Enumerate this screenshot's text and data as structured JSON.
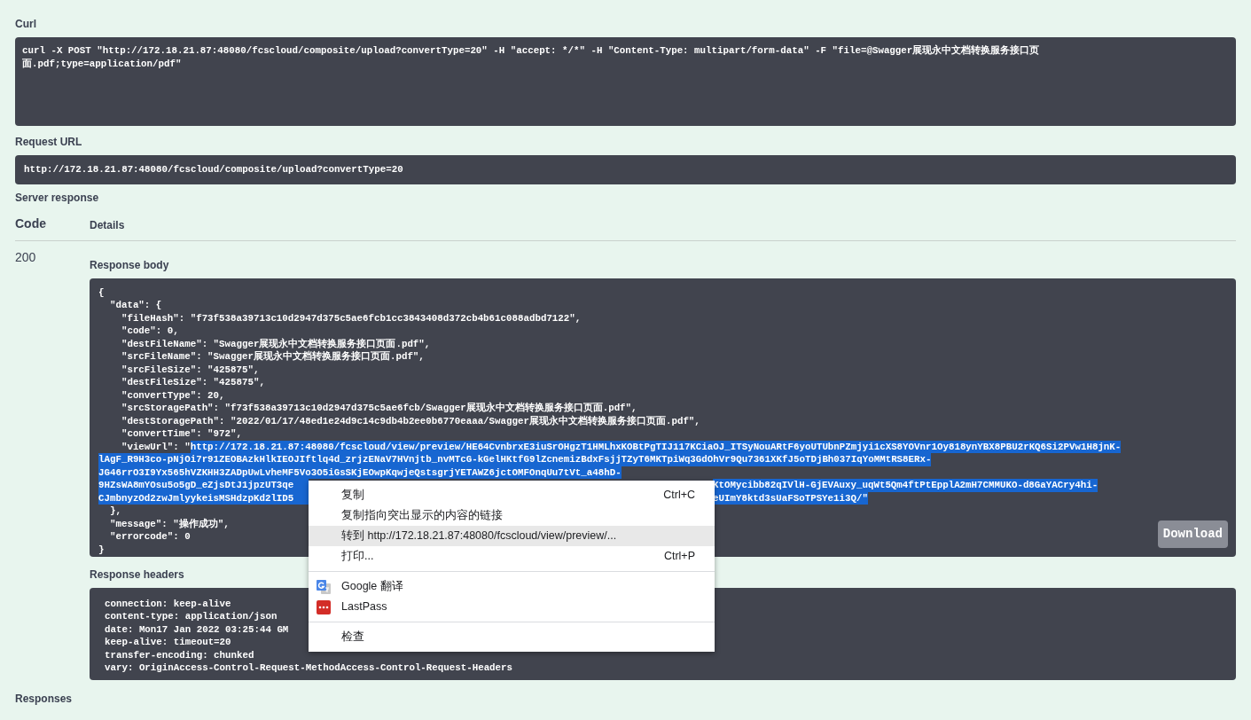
{
  "curl": {
    "label": "Curl",
    "lines": [
      "curl -X POST \"http://172.18.21.87:48080/fcscloud/composite/upload?convertType=20\" -H \"accept: */*\" -H \"Content-Type: multipart/form-data\" -F \"file=@Swagger展现永中文档转换服务接口页",
      "面.pdf;type=application/pdf\""
    ]
  },
  "request_url": {
    "label": "Request URL",
    "value": "http://172.18.21.87:48080/fcscloud/composite/upload?convertType=20"
  },
  "server_response": {
    "label": "Server response",
    "columns": [
      "Code",
      "Details"
    ],
    "code": "200",
    "response_body": {
      "label": "Response body",
      "lines": [
        "{",
        "  \"data\": {",
        "    \"fileHash\": \"f73f538a39713c10d2947d375c5ae6fcb1cc3843408d372cb4b61c088adbd7122\",",
        "    \"code\": 0,",
        "    \"destFileName\": \"Swagger展现永中文档转换服务接口页面.pdf\",",
        "    \"srcFileName\": \"Swagger展现永中文档转换服务接口页面.pdf\",",
        "    \"srcFileSize\": \"425875\",",
        "    \"destFileSize\": \"425875\",",
        "    \"convertType\": 20,",
        "    \"srcStoragePath\": \"f73f538a39713c10d2947d375c5ae6fcb/Swagger展现永中文档转换服务接口页面.pdf\",",
        "    \"destStoragePath\": \"2022/01/17/48ed1e24d9c14c9db4b2ee0b6770eaaa/Swagger展现永中文档转换服务接口页面.pdf\",",
        "    \"convertTime\": \"972\","
      ],
      "view_url": {
        "key": "    \"viewUrl\": \"",
        "highlighted": true,
        "lines": [
          {
            "left": "http://172.18.21.87:48080/fcscloud/view/preview/HE64CvnbrxE3iuSrOHgzT1HMLhxKOBtPgTIJ117KCiaOJ_ITSyNouARtF6yoUTUbnPZmjyi1cXS8YOVnr1Oy818ynYBX8PBU2rKQ6Si2PVw1H8jnK-"
          },
          {
            "left": "lAgF_R9H3co-pNjOi7r91ZEOBAzkHlkIEOJIftlq4d_zrjzENaV7HVnjtb_nvMTcG-kGelHKtfG9lZcnemizBdxFsjjTZyT6MKTpiWq3GdOhVr9Qu7361XKfJ5oTDjBh037IqYoMMtRS8ERx-"
          },
          {
            "left": "JG46rrO3I9Yx565hVZKHH3ZADpUwLvheMF5Vo3O5iGsSKjEOwpKqwjeQstsgrjYETAWZ6jctOMFOnqUu7tVt_a48hD-"
          },
          {
            "left": "9HZsWA8mYOsu5o5gD_eZjsDtJ1jpzUT3qe",
            "right": "KtOMycibb82qIVlH-GjEVAuxy_uqWt5Qm4ftPtEpplA2mH7CMMUKO-d8GaYACry4hi-"
          },
          {
            "left": "CJmbnyzOd2zwJmlyykeisMSHdzpKd2lID5",
            "right": "eUImY8ktd3sUaFSoTPSYe1i3Q/\""
          }
        ]
      },
      "closing_lines": [
        "  },",
        "  \"message\": \"操作成功\",",
        "  \"errorcode\": 0",
        "}"
      ],
      "download_button": "Download"
    },
    "response_headers": {
      "label": "Response headers",
      "lines": [
        "connection: keep-alive",
        "content-type: application/json",
        "date: Mon17 Jan 2022 03:25:44 GM",
        "keep-alive: timeout=20",
        "transfer-encoding: chunked",
        "vary: OriginAccess-Control-Request-MethodAccess-Control-Request-Headers"
      ]
    }
  },
  "responses_label": "Responses",
  "context_menu": {
    "items": [
      {
        "kind": "item",
        "label": "复制",
        "shortcut": "Ctrl+C",
        "highlighted": false
      },
      {
        "kind": "item",
        "label": "复制指向突出显示的内容的链接",
        "highlighted": false
      },
      {
        "kind": "item",
        "label": "转到 http://172.18.21.87:48080/fcscloud/view/preview/...",
        "highlighted": true
      },
      {
        "kind": "item",
        "label": "打印...",
        "shortcut": "Ctrl+P",
        "highlighted": false
      },
      {
        "kind": "separator"
      },
      {
        "kind": "translator",
        "label": "Google 翻译",
        "highlighted": false
      },
      {
        "kind": "password",
        "label": "LastPass",
        "highlighted": false
      },
      {
        "kind": "separator"
      },
      {
        "kind": "item",
        "label": "检查",
        "highlighted": false
      }
    ]
  }
}
